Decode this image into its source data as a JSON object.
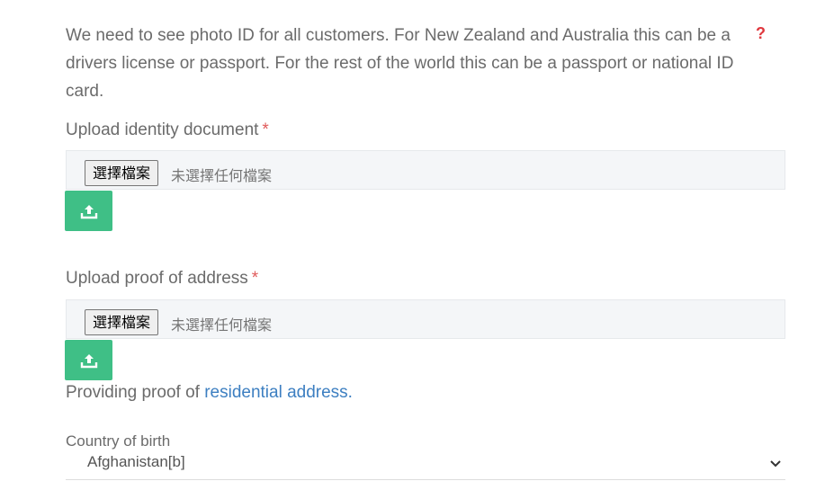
{
  "intro": {
    "text": "We need to see photo ID for all customers. For New Zealand and Australia this can be a drivers license or passport. For the rest of the world this can be a passport or national ID card.",
    "help_icon": "question-mark-icon",
    "help_color": "#e0383e"
  },
  "identity": {
    "label": "Upload identity document",
    "required_mark": "*",
    "file_button": "選擇檔案",
    "file_status": "未選擇任何檔案",
    "upload_icon": "upload-icon"
  },
  "address": {
    "label": "Upload proof of address",
    "required_mark": "*",
    "file_button": "選擇檔案",
    "file_status": "未選擇任何檔案",
    "upload_icon": "upload-icon"
  },
  "proof_note": {
    "prefix": "Providing proof of ",
    "link_text": "residential address."
  },
  "country_of_birth": {
    "label": "Country of birth",
    "selected": "Afghanistan[b]",
    "chevron_icon": "chevron-down-icon"
  },
  "colors": {
    "accent_green": "#3fbf86",
    "link_blue": "#3d7fc1",
    "required_red": "#e05a5a"
  }
}
